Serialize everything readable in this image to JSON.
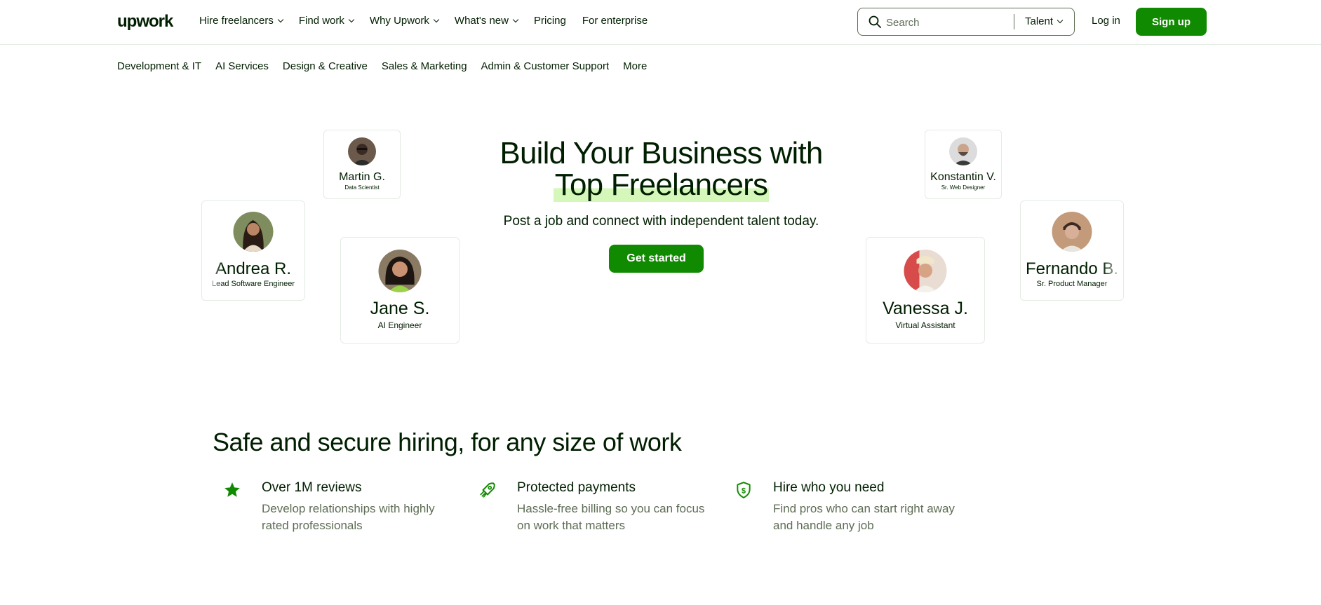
{
  "header": {
    "logo": "upwork",
    "nav": [
      {
        "label": "Hire freelancers",
        "dropdown": true
      },
      {
        "label": "Find work",
        "dropdown": true
      },
      {
        "label": "Why Upwork",
        "dropdown": true
      },
      {
        "label": "What's new",
        "dropdown": true
      },
      {
        "label": "Pricing",
        "dropdown": false
      },
      {
        "label": "For enterprise",
        "dropdown": false
      }
    ],
    "search": {
      "placeholder": "Search",
      "value": "",
      "scope": "Talent"
    },
    "login_label": "Log in",
    "signup_label": "Sign up"
  },
  "categories": [
    "Development & IT",
    "AI Services",
    "Design & Creative",
    "Sales & Marketing",
    "Admin & Customer Support",
    "More"
  ],
  "hero": {
    "title_line1": "Build Your Business with",
    "title_line2": "Top Freelancers",
    "subtitle": "Post a job and connect with independent talent today.",
    "cta_label": "Get started"
  },
  "freelancers": [
    {
      "name": "Martin G.",
      "role": "Data Scientist"
    },
    {
      "name": "Andrea R.",
      "role": "Lead Software Engineer"
    },
    {
      "name": "Jane S.",
      "role": "AI Engineer"
    },
    {
      "name": "Konstantin V.",
      "role": "Sr. Web Designer"
    },
    {
      "name": "Vanessa J.",
      "role": "Virtual Assistant"
    },
    {
      "name": "Fernando B.",
      "role": "Sr. Product Manager"
    }
  ],
  "section": {
    "title": "Safe and secure hiring, for any size of work",
    "features": [
      {
        "icon": "star-icon",
        "title": "Over 1M reviews",
        "desc_line1": "Develop relationships with highly",
        "desc_line2": "rated professionals"
      },
      {
        "icon": "rocket-icon",
        "title": "Protected payments",
        "desc_line1": "Hassle-free billing so you can focus",
        "desc_line2": "on work that matters"
      },
      {
        "icon": "shield-dollar-icon",
        "title": "Hire who you need",
        "desc_line1": "Find pros who can start right away",
        "desc_line2": "and handle any job"
      }
    ]
  },
  "colors": {
    "brand_green": "#108a00",
    "text": "#001e00",
    "muted": "#5e6d55",
    "highlight": "#d5f7b9"
  }
}
